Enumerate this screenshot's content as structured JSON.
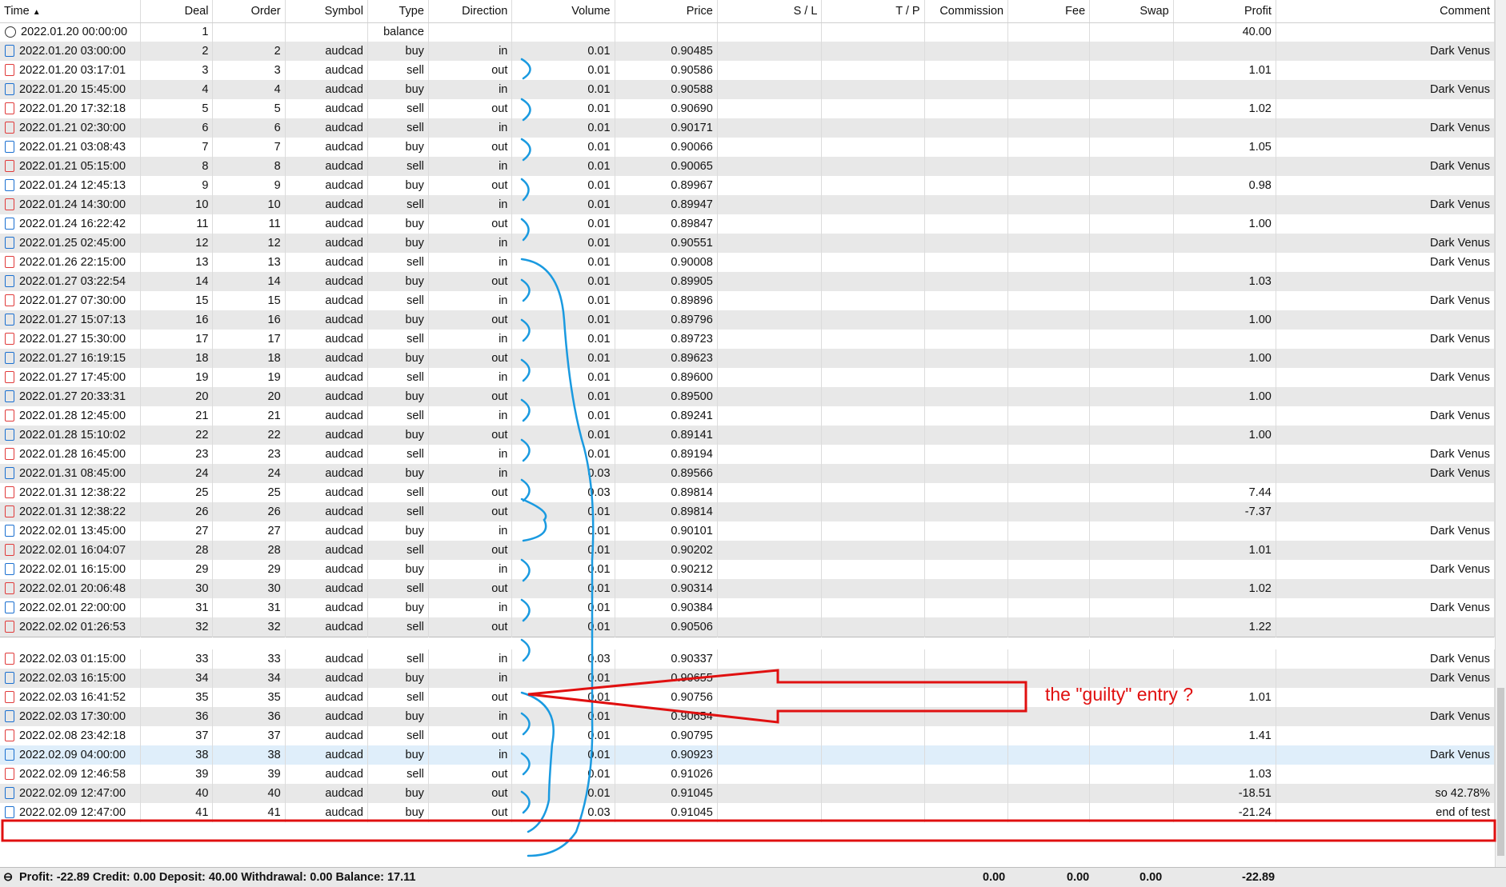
{
  "columns": [
    "Time",
    "Deal",
    "Order",
    "Symbol",
    "Type",
    "Direction",
    "Volume",
    "Price",
    "S / L",
    "T / P",
    "Commission",
    "Fee",
    "Swap",
    "Profit",
    "Comment"
  ],
  "rows": [
    {
      "time": "2022.01.20 00:00:00",
      "deal": "1",
      "order": "",
      "symbol": "",
      "type": "balance",
      "direction": "",
      "volume": "",
      "price": "",
      "profit": "40.00",
      "comment": "",
      "icon": "balance"
    },
    {
      "time": "2022.01.20 03:00:00",
      "deal": "2",
      "order": "2",
      "symbol": "audcad",
      "type": "buy",
      "direction": "in",
      "volume": "0.01",
      "price": "0.90485",
      "profit": "",
      "comment": "Dark Venus",
      "icon": "blue"
    },
    {
      "time": "2022.01.20 03:17:01",
      "deal": "3",
      "order": "3",
      "symbol": "audcad",
      "type": "sell",
      "direction": "out",
      "volume": "0.01",
      "price": "0.90586",
      "profit": "1.01",
      "comment": "",
      "icon": "red"
    },
    {
      "time": "2022.01.20 15:45:00",
      "deal": "4",
      "order": "4",
      "symbol": "audcad",
      "type": "buy",
      "direction": "in",
      "volume": "0.01",
      "price": "0.90588",
      "profit": "",
      "comment": "Dark Venus",
      "icon": "blue"
    },
    {
      "time": "2022.01.20 17:32:18",
      "deal": "5",
      "order": "5",
      "symbol": "audcad",
      "type": "sell",
      "direction": "out",
      "volume": "0.01",
      "price": "0.90690",
      "profit": "1.02",
      "comment": "",
      "icon": "red"
    },
    {
      "time": "2022.01.21 02:30:00",
      "deal": "6",
      "order": "6",
      "symbol": "audcad",
      "type": "sell",
      "direction": "in",
      "volume": "0.01",
      "price": "0.90171",
      "profit": "",
      "comment": "Dark Venus",
      "icon": "red"
    },
    {
      "time": "2022.01.21 03:08:43",
      "deal": "7",
      "order": "7",
      "symbol": "audcad",
      "type": "buy",
      "direction": "out",
      "volume": "0.01",
      "price": "0.90066",
      "profit": "1.05",
      "comment": "",
      "icon": "blue"
    },
    {
      "time": "2022.01.21 05:15:00",
      "deal": "8",
      "order": "8",
      "symbol": "audcad",
      "type": "sell",
      "direction": "in",
      "volume": "0.01",
      "price": "0.90065",
      "profit": "",
      "comment": "Dark Venus",
      "icon": "red"
    },
    {
      "time": "2022.01.24 12:45:13",
      "deal": "9",
      "order": "9",
      "symbol": "audcad",
      "type": "buy",
      "direction": "out",
      "volume": "0.01",
      "price": "0.89967",
      "profit": "0.98",
      "comment": "",
      "icon": "blue"
    },
    {
      "time": "2022.01.24 14:30:00",
      "deal": "10",
      "order": "10",
      "symbol": "audcad",
      "type": "sell",
      "direction": "in",
      "volume": "0.01",
      "price": "0.89947",
      "profit": "",
      "comment": "Dark Venus",
      "icon": "red"
    },
    {
      "time": "2022.01.24 16:22:42",
      "deal": "11",
      "order": "11",
      "symbol": "audcad",
      "type": "buy",
      "direction": "out",
      "volume": "0.01",
      "price": "0.89847",
      "profit": "1.00",
      "comment": "",
      "icon": "blue"
    },
    {
      "time": "2022.01.25 02:45:00",
      "deal": "12",
      "order": "12",
      "symbol": "audcad",
      "type": "buy",
      "direction": "in",
      "volume": "0.01",
      "price": "0.90551",
      "profit": "",
      "comment": "Dark Venus",
      "icon": "blue"
    },
    {
      "time": "2022.01.26 22:15:00",
      "deal": "13",
      "order": "13",
      "symbol": "audcad",
      "type": "sell",
      "direction": "in",
      "volume": "0.01",
      "price": "0.90008",
      "profit": "",
      "comment": "Dark Venus",
      "icon": "red"
    },
    {
      "time": "2022.01.27 03:22:54",
      "deal": "14",
      "order": "14",
      "symbol": "audcad",
      "type": "buy",
      "direction": "out",
      "volume": "0.01",
      "price": "0.89905",
      "profit": "1.03",
      "comment": "",
      "icon": "blue"
    },
    {
      "time": "2022.01.27 07:30:00",
      "deal": "15",
      "order": "15",
      "symbol": "audcad",
      "type": "sell",
      "direction": "in",
      "volume": "0.01",
      "price": "0.89896",
      "profit": "",
      "comment": "Dark Venus",
      "icon": "red"
    },
    {
      "time": "2022.01.27 15:07:13",
      "deal": "16",
      "order": "16",
      "symbol": "audcad",
      "type": "buy",
      "direction": "out",
      "volume": "0.01",
      "price": "0.89796",
      "profit": "1.00",
      "comment": "",
      "icon": "blue"
    },
    {
      "time": "2022.01.27 15:30:00",
      "deal": "17",
      "order": "17",
      "symbol": "audcad",
      "type": "sell",
      "direction": "in",
      "volume": "0.01",
      "price": "0.89723",
      "profit": "",
      "comment": "Dark Venus",
      "icon": "red"
    },
    {
      "time": "2022.01.27 16:19:15",
      "deal": "18",
      "order": "18",
      "symbol": "audcad",
      "type": "buy",
      "direction": "out",
      "volume": "0.01",
      "price": "0.89623",
      "profit": "1.00",
      "comment": "",
      "icon": "blue"
    },
    {
      "time": "2022.01.27 17:45:00",
      "deal": "19",
      "order": "19",
      "symbol": "audcad",
      "type": "sell",
      "direction": "in",
      "volume": "0.01",
      "price": "0.89600",
      "profit": "",
      "comment": "Dark Venus",
      "icon": "red"
    },
    {
      "time": "2022.01.27 20:33:31",
      "deal": "20",
      "order": "20",
      "symbol": "audcad",
      "type": "buy",
      "direction": "out",
      "volume": "0.01",
      "price": "0.89500",
      "profit": "1.00",
      "comment": "",
      "icon": "blue"
    },
    {
      "time": "2022.01.28 12:45:00",
      "deal": "21",
      "order": "21",
      "symbol": "audcad",
      "type": "sell",
      "direction": "in",
      "volume": "0.01",
      "price": "0.89241",
      "profit": "",
      "comment": "Dark Venus",
      "icon": "red"
    },
    {
      "time": "2022.01.28 15:10:02",
      "deal": "22",
      "order": "22",
      "symbol": "audcad",
      "type": "buy",
      "direction": "out",
      "volume": "0.01",
      "price": "0.89141",
      "profit": "1.00",
      "comment": "",
      "icon": "blue"
    },
    {
      "time": "2022.01.28 16:45:00",
      "deal": "23",
      "order": "23",
      "symbol": "audcad",
      "type": "sell",
      "direction": "in",
      "volume": "0.01",
      "price": "0.89194",
      "profit": "",
      "comment": "Dark Venus",
      "icon": "red"
    },
    {
      "time": "2022.01.31 08:45:00",
      "deal": "24",
      "order": "24",
      "symbol": "audcad",
      "type": "buy",
      "direction": "in",
      "volume": "0.03",
      "price": "0.89566",
      "profit": "",
      "comment": "Dark Venus",
      "icon": "blue"
    },
    {
      "time": "2022.01.31 12:38:22",
      "deal": "25",
      "order": "25",
      "symbol": "audcad",
      "type": "sell",
      "direction": "out",
      "volume": "0.03",
      "price": "0.89814",
      "profit": "7.44",
      "comment": "",
      "icon": "red"
    },
    {
      "time": "2022.01.31 12:38:22",
      "deal": "26",
      "order": "26",
      "symbol": "audcad",
      "type": "sell",
      "direction": "out",
      "volume": "0.01",
      "price": "0.89814",
      "profit": "-7.37",
      "comment": "",
      "icon": "red"
    },
    {
      "time": "2022.02.01 13:45:00",
      "deal": "27",
      "order": "27",
      "symbol": "audcad",
      "type": "buy",
      "direction": "in",
      "volume": "0.01",
      "price": "0.90101",
      "profit": "",
      "comment": "Dark Venus",
      "icon": "blue"
    },
    {
      "time": "2022.02.01 16:04:07",
      "deal": "28",
      "order": "28",
      "symbol": "audcad",
      "type": "sell",
      "direction": "out",
      "volume": "0.01",
      "price": "0.90202",
      "profit": "1.01",
      "comment": "",
      "icon": "red"
    },
    {
      "time": "2022.02.01 16:15:00",
      "deal": "29",
      "order": "29",
      "symbol": "audcad",
      "type": "buy",
      "direction": "in",
      "volume": "0.01",
      "price": "0.90212",
      "profit": "",
      "comment": "Dark Venus",
      "icon": "blue"
    },
    {
      "time": "2022.02.01 20:06:48",
      "deal": "30",
      "order": "30",
      "symbol": "audcad",
      "type": "sell",
      "direction": "out",
      "volume": "0.01",
      "price": "0.90314",
      "profit": "1.02",
      "comment": "",
      "icon": "red"
    },
    {
      "time": "2022.02.01 22:00:00",
      "deal": "31",
      "order": "31",
      "symbol": "audcad",
      "type": "buy",
      "direction": "in",
      "volume": "0.01",
      "price": "0.90384",
      "profit": "",
      "comment": "Dark Venus",
      "icon": "blue"
    },
    {
      "time": "2022.02.02 01:26:53",
      "deal": "32",
      "order": "32",
      "symbol": "audcad",
      "type": "sell",
      "direction": "out",
      "volume": "0.01",
      "price": "0.90506",
      "profit": "1.22",
      "comment": "",
      "icon": "red",
      "sep_after": true
    },
    {
      "time": "2022.02.03 01:15:00",
      "deal": "33",
      "order": "33",
      "symbol": "audcad",
      "type": "sell",
      "direction": "in",
      "volume": "0.03",
      "price": "0.90337",
      "profit": "",
      "comment": "Dark Venus",
      "icon": "red"
    },
    {
      "time": "2022.02.03 16:15:00",
      "deal": "34",
      "order": "34",
      "symbol": "audcad",
      "type": "buy",
      "direction": "in",
      "volume": "0.01",
      "price": "0.90655",
      "profit": "",
      "comment": "Dark Venus",
      "icon": "blue"
    },
    {
      "time": "2022.02.03 16:41:52",
      "deal": "35",
      "order": "35",
      "symbol": "audcad",
      "type": "sell",
      "direction": "out",
      "volume": "0.01",
      "price": "0.90756",
      "profit": "1.01",
      "comment": "",
      "icon": "red"
    },
    {
      "time": "2022.02.03 17:30:00",
      "deal": "36",
      "order": "36",
      "symbol": "audcad",
      "type": "buy",
      "direction": "in",
      "volume": "0.01",
      "price": "0.90654",
      "profit": "",
      "comment": "Dark Venus",
      "icon": "blue"
    },
    {
      "time": "2022.02.08 23:42:18",
      "deal": "37",
      "order": "37",
      "symbol": "audcad",
      "type": "sell",
      "direction": "out",
      "volume": "0.01",
      "price": "0.90795",
      "profit": "1.41",
      "comment": "",
      "icon": "red"
    },
    {
      "time": "2022.02.09 04:00:00",
      "deal": "38",
      "order": "38",
      "symbol": "audcad",
      "type": "buy",
      "direction": "in",
      "volume": "0.01",
      "price": "0.90923",
      "profit": "",
      "comment": "Dark Venus",
      "icon": "blue",
      "highlight": true
    },
    {
      "time": "2022.02.09 12:46:58",
      "deal": "39",
      "order": "39",
      "symbol": "audcad",
      "type": "sell",
      "direction": "out",
      "volume": "0.01",
      "price": "0.91026",
      "profit": "1.03",
      "comment": "",
      "icon": "red"
    },
    {
      "time": "2022.02.09 12:47:00",
      "deal": "40",
      "order": "40",
      "symbol": "audcad",
      "type": "buy",
      "direction": "out",
      "volume": "0.01",
      "price": "0.91045",
      "profit": "-18.51",
      "comment": "so 42.78%",
      "icon": "blue"
    },
    {
      "time": "2022.02.09 12:47:00",
      "deal": "41",
      "order": "41",
      "symbol": "audcad",
      "type": "buy",
      "direction": "out",
      "volume": "0.03",
      "price": "0.91045",
      "profit": "-21.24",
      "comment": "end of test",
      "icon": "blue"
    }
  ],
  "status": {
    "summary": "Profit: -22.89  Credit: 0.00  Deposit: 40.00  Withdrawal: 0.00  Balance: 17.11",
    "commission": "0.00",
    "fee": "0.00",
    "swap": "0.00",
    "profit": "-22.89"
  },
  "annotation": {
    "text": "the \"guilty\" entry ?",
    "color_red": "#e01010",
    "color_blue": "#1a9ae0"
  }
}
